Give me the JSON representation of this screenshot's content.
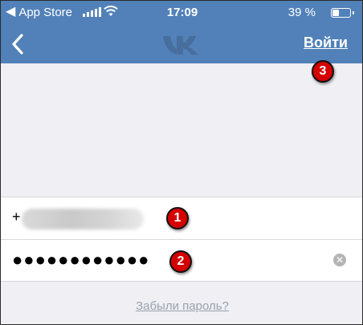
{
  "status_bar": {
    "back_app_label": "App Store",
    "time": "17:09",
    "battery_percent": "39 %",
    "battery_level": 0.39,
    "signal_icon": "signal-bars-icon",
    "wifi_icon": "wifi-icon"
  },
  "nav": {
    "back_icon": "chevron-left-icon",
    "logo_icon": "vk-logo-icon",
    "login_label": "Войти"
  },
  "form": {
    "phone_prefix": "+",
    "password_masked": "●●●●●●●●●●●●",
    "clear_icon": "clear-circle-icon"
  },
  "forgot_password_link": "Забыли пароль?",
  "annotations": [
    "1",
    "2",
    "3"
  ],
  "colors": {
    "header_bg": "#5181b8",
    "page_bg": "#efeff4",
    "badge_red": "#d50000",
    "link_gray": "#99a2ad"
  }
}
